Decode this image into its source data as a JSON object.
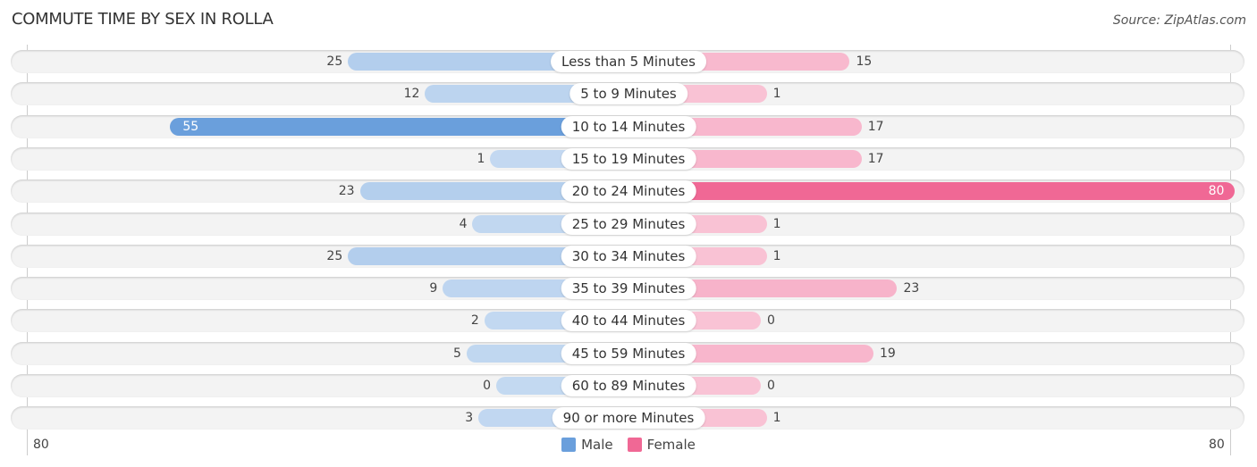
{
  "chart_data": {
    "type": "bar",
    "orientation": "horizontal-diverging",
    "title": "COMMUTE TIME BY SEX IN ROLLA",
    "source": "Source: ZipAtlas.com",
    "categories": [
      "Less than 5 Minutes",
      "5 to 9 Minutes",
      "10 to 14 Minutes",
      "15 to 19 Minutes",
      "20 to 24 Minutes",
      "25 to 29 Minutes",
      "30 to 34 Minutes",
      "35 to 39 Minutes",
      "40 to 44 Minutes",
      "45 to 59 Minutes",
      "60 to 89 Minutes",
      "90 or more Minutes"
    ],
    "series": [
      {
        "name": "Male",
        "color": "#6a9fdc",
        "values": [
          25,
          12,
          55,
          1,
          23,
          4,
          25,
          9,
          2,
          5,
          0,
          3
        ]
      },
      {
        "name": "Female",
        "color": "#f06895",
        "values": [
          15,
          1,
          17,
          17,
          80,
          1,
          1,
          23,
          0,
          19,
          0,
          1
        ]
      }
    ],
    "axis": {
      "left_label": "80",
      "right_label": "80",
      "max": 80
    },
    "legend": {
      "position": "bottom-center",
      "items": [
        "Male",
        "Female"
      ]
    }
  }
}
